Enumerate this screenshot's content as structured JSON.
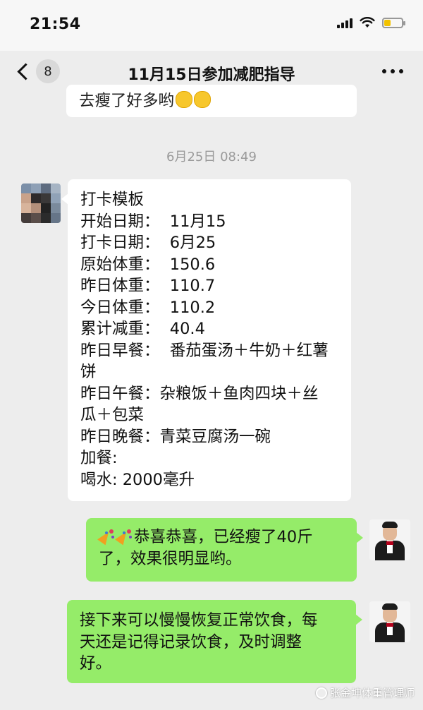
{
  "status_bar": {
    "time": "21:54",
    "icons": [
      "signal-icon",
      "wifi-icon",
      "battery-icon"
    ],
    "battery_color": "#f2c200"
  },
  "nav": {
    "unread_count": "8",
    "title": "11月15日参加减肥指导",
    "back_icon": "chevron-left-icon",
    "more_icon": "more-dots-icon"
  },
  "messages": {
    "previous": {
      "text": "去瘦了好多哟"
    },
    "timestamp": "6月25日 08:49",
    "checkin": {
      "lines": [
        "打卡模板",
        "开始日期：  11月15",
        "打卡日期：  6月25",
        "原始体重：  150.6",
        "昨日体重：  110.7",
        "今日体重：  110.2",
        "累计减重：  40.4",
        "昨日早餐：  番茄蛋汤＋牛奶＋红薯",
        "饼",
        "昨日午餐：杂粮饭＋鱼肉四块＋丝",
        "瓜＋包菜",
        "昨日晚餐：青菜豆腐汤一碗",
        "加餐:",
        "喝水: 2000毫升"
      ]
    },
    "congrats": {
      "line1": "恭喜恭喜，已经瘦了40斤",
      "line2": "了，效果很明显哟。"
    },
    "advice": {
      "line1": "接下来可以慢慢恢复正常饮食，每",
      "line2": "天还是记得记录饮食，及时调整",
      "line3": "好。"
    }
  },
  "watermark": {
    "text": "张金坤体重管理师"
  },
  "colors": {
    "background": "#ededed",
    "bubble_self": "#95ec69",
    "bubble_other": "#ffffff",
    "timestamp": "#9a9a9a"
  }
}
